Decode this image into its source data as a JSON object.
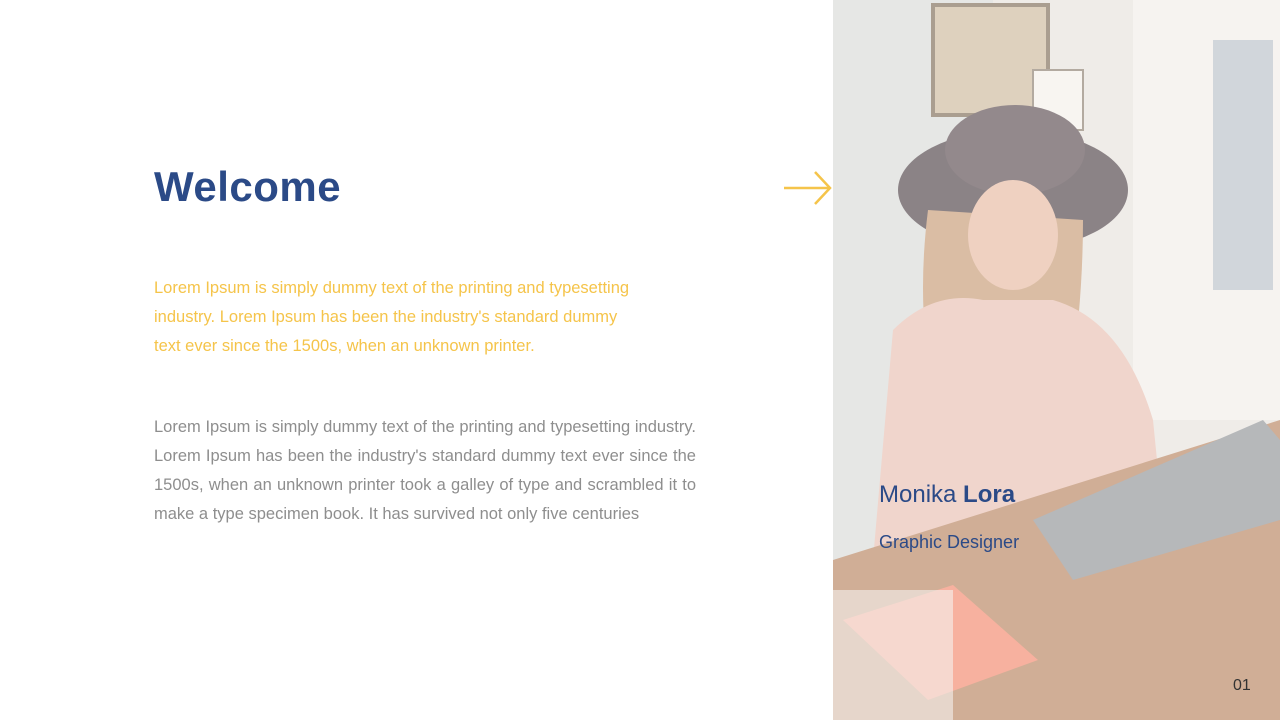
{
  "slide": {
    "title": "Welcome",
    "intro_text": "Lorem Ipsum is simply dummy text of the printing and typesetting industry. Lorem Ipsum has been the industry's standard dummy text ever since the 1500s, when an unknown printer.",
    "body_text": "Lorem Ipsum is simply dummy text of the printing and typesetting industry. Lorem Ipsum has been the industry's standard dummy text ever since the 1500s, when an unknown printer took a galley of type and scrambled it to make a type specimen book. It has survived not only five centuries",
    "page_number": "01"
  },
  "profile": {
    "first_name": "Monika",
    "last_name": "Lora",
    "role": "Graphic Designer"
  },
  "icons": {
    "arrow": "arrow-right-icon"
  },
  "colors": {
    "title": "#2b4a87",
    "accent": "#f5c44a",
    "body": "#8e8e8e",
    "photo_overlay": "#ffffff"
  }
}
